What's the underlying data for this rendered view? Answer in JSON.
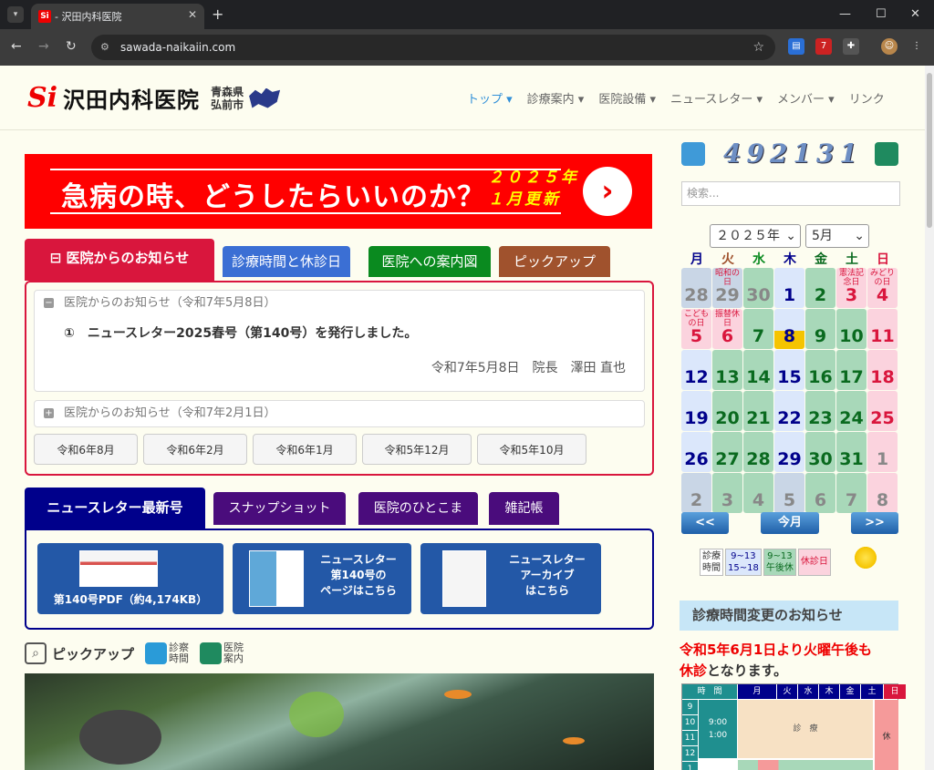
{
  "browser": {
    "tab_title": "- 沢田内科医院",
    "favicon": "Si",
    "url": "sawada-naikaiin.com",
    "ext_badge": "7"
  },
  "site": {
    "logo_mark": "Si",
    "logo_name": "沢田内科医院",
    "pref_line1": "青森県",
    "pref_line2": "弘前市"
  },
  "nav": [
    {
      "label": "トップ ▾",
      "active": true
    },
    {
      "label": "診療案内 ▾",
      "active": false
    },
    {
      "label": "医院設備 ▾",
      "active": false
    },
    {
      "label": "ニュースレター ▾",
      "active": false
    },
    {
      "label": "メンバー ▾",
      "active": false
    },
    {
      "label": "リンク",
      "active": false
    }
  ],
  "banner": {
    "title": "急病の時、どうしたらいいのか？",
    "year_line1": "２０２５年",
    "year_line2": "１月更新"
  },
  "notice_tabs": [
    {
      "label": "医院からのお知らせ",
      "color": "#d9163d"
    },
    {
      "label": "診療時間と休診日",
      "color": "#3b6fd4"
    },
    {
      "label": "医院への案内図",
      "color": "#0a8a1f"
    },
    {
      "label": "ピックアップ",
      "color": "#a0522d"
    }
  ],
  "notice": {
    "open_header": "医院からのお知らせ（令和7年5月8日）",
    "item": "①　ニュースレター2025春号（第140号）を発行しました。",
    "signature": "令和7年5月8日　院長　澤田 直也",
    "closed_header": "医院からのお知らせ（令和7年2月1日）",
    "archive": [
      "令和6年8月",
      "令和6年2月",
      "令和6年1月",
      "令和5年12月",
      "令和5年10月"
    ]
  },
  "news_tabs": [
    {
      "label": "ニュースレター最新号"
    },
    {
      "label": "スナップショット"
    },
    {
      "label": "医院のひとこま"
    },
    {
      "label": "雑記帳"
    }
  ],
  "news_buttons": [
    {
      "line1": "",
      "line2": "第140号PDF（約4,174KB）"
    },
    {
      "line1": "ニュースレター",
      "line2": "第140号の",
      "line3": "ページはこちら"
    },
    {
      "line1": "ニュースレター",
      "line2": "アーカイブ",
      "line3": "はこちら"
    }
  ],
  "pickup": {
    "title": "ピックアップ",
    "link1_a": "診察",
    "link1_b": "時間",
    "link2_a": "医院",
    "link2_b": "案内"
  },
  "sidebar": {
    "counter": "492131",
    "search_placeholder": "検索...",
    "year_select": "２０２５年",
    "month_select": "5月",
    "dow": [
      "月",
      "火",
      "水",
      "木",
      "金",
      "土",
      "日"
    ],
    "dow_colors": [
      "#00008b",
      "#a0522d",
      "#0a8a1f",
      "#00008b",
      "#0a6a1f",
      "#0a6a1f",
      "#d9163d"
    ],
    "calendar": [
      [
        {
          "d": "28",
          "t": "o"
        },
        {
          "d": "29",
          "t": "o",
          "h": "昭和の日"
        },
        {
          "d": "30",
          "t": "og"
        },
        {
          "d": "1",
          "t": "b"
        },
        {
          "d": "2",
          "t": "g"
        },
        {
          "d": "3",
          "t": "r",
          "h": "憲法記念日"
        },
        {
          "d": "4",
          "t": "r",
          "h": "みどりの日"
        }
      ],
      [
        {
          "d": "5",
          "t": "r",
          "h": "こどもの日"
        },
        {
          "d": "6",
          "t": "r",
          "h": "振替休日"
        },
        {
          "d": "7",
          "t": "g"
        },
        {
          "d": "8",
          "t": "today"
        },
        {
          "d": "9",
          "t": "g"
        },
        {
          "d": "10",
          "t": "g"
        },
        {
          "d": "11",
          "t": "r"
        }
      ],
      [
        {
          "d": "12",
          "t": "b"
        },
        {
          "d": "13",
          "t": "g"
        },
        {
          "d": "14",
          "t": "g"
        },
        {
          "d": "15",
          "t": "b"
        },
        {
          "d": "16",
          "t": "g"
        },
        {
          "d": "17",
          "t": "g"
        },
        {
          "d": "18",
          "t": "r"
        }
      ],
      [
        {
          "d": "19",
          "t": "b"
        },
        {
          "d": "20",
          "t": "g"
        },
        {
          "d": "21",
          "t": "g"
        },
        {
          "d": "22",
          "t": "b"
        },
        {
          "d": "23",
          "t": "g"
        },
        {
          "d": "24",
          "t": "g"
        },
        {
          "d": "25",
          "t": "r"
        }
      ],
      [
        {
          "d": "26",
          "t": "b"
        },
        {
          "d": "27",
          "t": "g"
        },
        {
          "d": "28",
          "t": "g"
        },
        {
          "d": "29",
          "t": "b"
        },
        {
          "d": "30",
          "t": "g"
        },
        {
          "d": "31",
          "t": "g"
        },
        {
          "d": "1",
          "t": "or"
        }
      ],
      [
        {
          "d": "2",
          "t": "ob"
        },
        {
          "d": "3",
          "t": "og"
        },
        {
          "d": "4",
          "t": "og"
        },
        {
          "d": "5",
          "t": "ob"
        },
        {
          "d": "6",
          "t": "og"
        },
        {
          "d": "7",
          "t": "og"
        },
        {
          "d": "8",
          "t": "or"
        }
      ]
    ],
    "prev": "<<",
    "this_month": "今月",
    "next": ">>",
    "legend": [
      {
        "a": "診療",
        "b": "時間",
        "bg": "#fff",
        "c": "#333"
      },
      {
        "a": "9~13",
        "b": "15~18",
        "bg": "#dbe7fb",
        "c": "#00008b"
      },
      {
        "a": "9~13",
        "b": "午後休",
        "bg": "#a8d8b9",
        "c": "#0a6a1f"
      },
      {
        "a": "休診日",
        "b": "",
        "bg": "#fbd3de",
        "c": "#d9163d"
      }
    ],
    "change_title": "診療時間変更のお知らせ",
    "change_red": "令和5年6月1日より火曜午後も",
    "change_red2": "休診",
    "change_rest": "となります。",
    "sched_header": [
      "時　間",
      "月",
      "火",
      "水",
      "木",
      "金",
      "土",
      "日"
    ],
    "sched_rows": [
      "9",
      "10",
      "11",
      "12",
      "1"
    ],
    "sched_time1": "9:00",
    "sched_time2": "1:00",
    "sched_label": "診　療",
    "sched_rest": "休"
  }
}
